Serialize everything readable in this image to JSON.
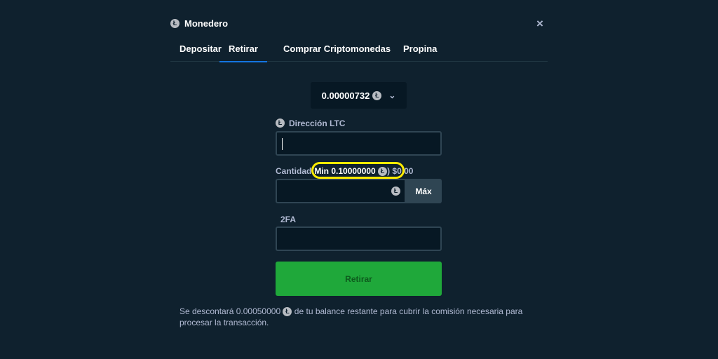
{
  "header": {
    "title": "Monedero",
    "coin_icon": "litecoin-icon",
    "close_label": "×"
  },
  "tabs": [
    {
      "label": "Depositar",
      "active": false
    },
    {
      "label": "Retirar",
      "active": true
    },
    {
      "label": "Comprar Criptomonedas",
      "active": false
    },
    {
      "label": "Propina",
      "active": false
    }
  ],
  "balance": {
    "amount": "0.00000732",
    "chevron": "⌄"
  },
  "address": {
    "label": "Dirección LTC",
    "value": "",
    "placeholder": ""
  },
  "amount": {
    "label": "Cantidad",
    "min_text": "(Min 0.10000000",
    "min_close": ")",
    "fiat": "$0,00",
    "value": "",
    "max_label": "Máx"
  },
  "twofa": {
    "label": "2FA",
    "value": ""
  },
  "submit_label": "Retirar",
  "note": {
    "before": "Se descontará 0.00050000",
    "after": " de tu balance restante para cubrir la comisión necesaria para procesar la transacción."
  },
  "colors": {
    "background": "#0f212e",
    "input_dark": "#071824",
    "accent_blue": "#1475e1",
    "submit_green": "#1fa83a",
    "highlight_yellow": "#ffeb00"
  }
}
